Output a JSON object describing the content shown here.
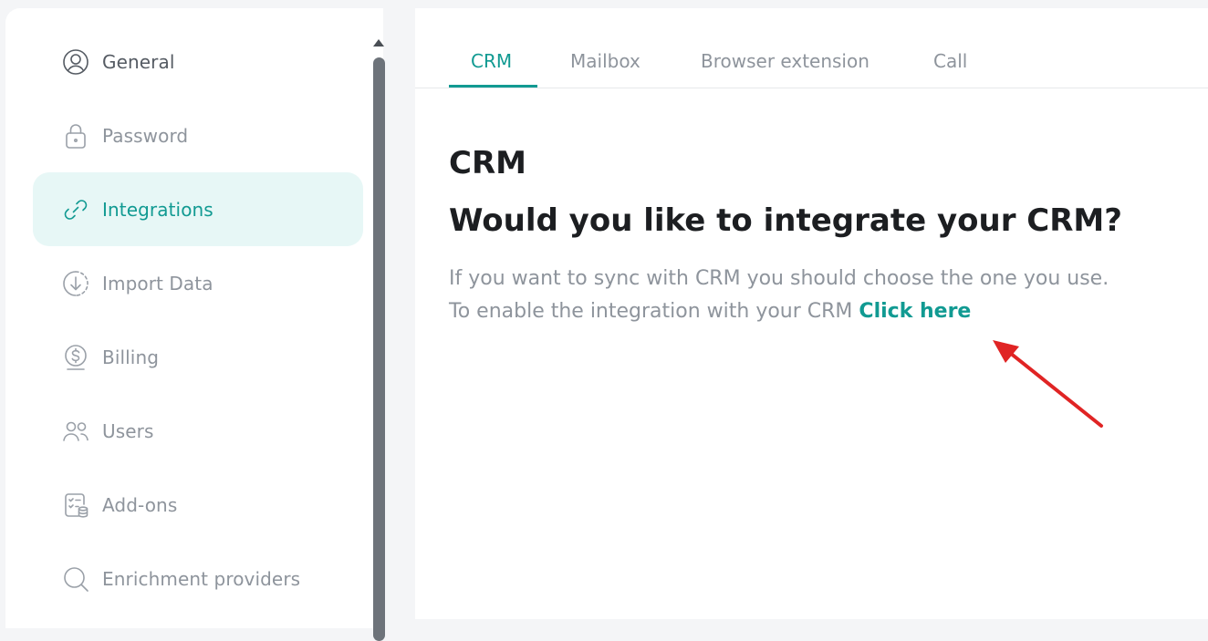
{
  "sidebar": {
    "items": [
      {
        "label": "General",
        "icon": "user-circle-icon"
      },
      {
        "label": "Password",
        "icon": "lock-icon"
      },
      {
        "label": "Integrations",
        "icon": "link-icon"
      },
      {
        "label": "Import Data",
        "icon": "download-icon"
      },
      {
        "label": "Billing",
        "icon": "dollar-coin-icon"
      },
      {
        "label": "Users",
        "icon": "users-icon"
      },
      {
        "label": "Add-ons",
        "icon": "checklist-icon"
      },
      {
        "label": "Enrichment providers",
        "icon": "search-icon"
      }
    ],
    "active": "Integrations"
  },
  "tabs": [
    {
      "label": "CRM"
    },
    {
      "label": "Mailbox"
    },
    {
      "label": "Browser extension"
    },
    {
      "label": "Call"
    }
  ],
  "active_tab": "CRM",
  "content": {
    "title": "CRM",
    "heading": "Would you like to integrate your CRM?",
    "line1": "If you want to sync with CRM you should choose the one you use.",
    "line2_prefix": "To enable the integration with your CRM ",
    "link_label": "Click here"
  },
  "colors": {
    "accent": "#119a92",
    "active_bg": "#e7f7f6",
    "annotation_arrow": "#e02424"
  }
}
